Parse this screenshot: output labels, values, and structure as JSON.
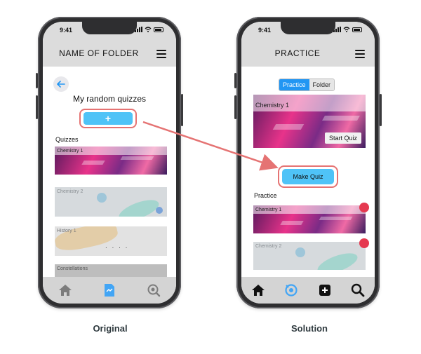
{
  "left_phone": {
    "status_time": "9:41",
    "header_title": "NAME OF FOLDER",
    "folder_title": "My random quizzes",
    "add_button_label": "+",
    "section_label": "Quizzes",
    "quizzes": [
      {
        "label": "Chemistry 1"
      },
      {
        "label": "Chemistry 2"
      },
      {
        "label": "History 1"
      },
      {
        "label": "Constellations"
      }
    ],
    "history_dots": ". . . ."
  },
  "right_phone": {
    "status_time": "9:41",
    "header_title": "PRACTICE",
    "segmented": {
      "practice": "Practice",
      "folder": "Folder"
    },
    "featured": {
      "label": "Chemistry 1",
      "start_button": "Start Quiz"
    },
    "make_quiz_label": "Make Quiz",
    "section_label": "Practice",
    "practice_items": [
      {
        "label": "Chemistry 1"
      },
      {
        "label": "Chemistry 2"
      }
    ]
  },
  "captions": {
    "original": "Original",
    "solution": "Solution"
  },
  "icons": {
    "back": "arrow-left-icon",
    "menu": "hamburger-menu-icon",
    "home": "home-icon",
    "document": "document-icon",
    "search_settings": "search-gear-icon",
    "practice": "practice-timer-icon",
    "add": "plus-square-icon",
    "search": "search-icon"
  },
  "colors": {
    "accent_blue": "#4fc3f7",
    "segment_active": "#2196f3",
    "highlight_outline": "#e57373",
    "delete_dot": "#e53950",
    "bar_gray": "#dcdcdc"
  }
}
